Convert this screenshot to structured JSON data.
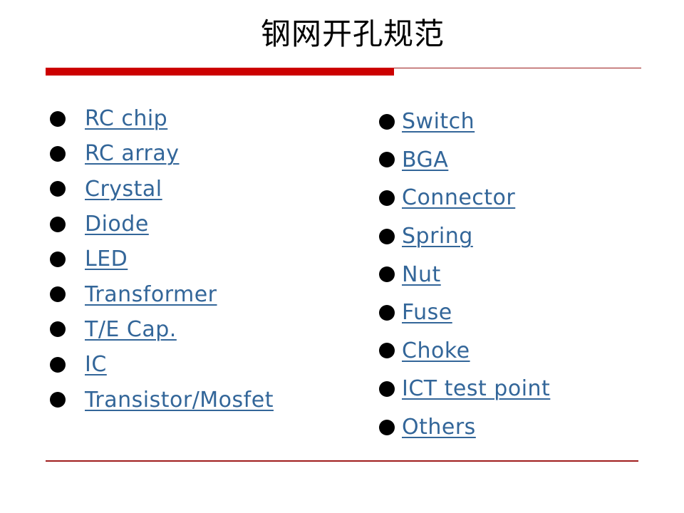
{
  "slide": {
    "title": "钢网开孔规范",
    "colors": {
      "accent_bar": "#cc0000",
      "accent_line": "#9b1b1b",
      "link": "#336699",
      "bullet": "#000000"
    },
    "left_list": {
      "items": [
        {
          "label": "RC chip",
          "icon": "bullet-dot-icon"
        },
        {
          "label": "RC array",
          "icon": "bullet-dot-icon"
        },
        {
          "label": "Crystal",
          "icon": "bullet-dot-icon"
        },
        {
          "label": "Diode",
          "icon": "bullet-dot-icon"
        },
        {
          "label": "LED",
          "icon": "bullet-dot-icon"
        },
        {
          "label": "Transformer",
          "icon": "bullet-dot-icon"
        },
        {
          "label": "T/E Cap.",
          "icon": "bullet-dot-icon"
        },
        {
          "label": "IC",
          "icon": "bullet-dot-icon"
        },
        {
          "label": "Transistor/Mosfet",
          "icon": "bullet-dot-icon"
        }
      ]
    },
    "right_list": {
      "items": [
        {
          "label": "Switch",
          "icon": "bullet-dot-icon"
        },
        {
          "label": "BGA",
          "icon": "bullet-dot-icon"
        },
        {
          "label": "Connector",
          "icon": "bullet-dot-icon"
        },
        {
          "label": "Spring",
          "icon": "bullet-dot-icon"
        },
        {
          "label": "Nut",
          "icon": "bullet-dot-icon"
        },
        {
          "label": "Fuse",
          "icon": "bullet-dot-icon"
        },
        {
          "label": "Choke",
          "icon": "bullet-dot-icon"
        },
        {
          "label": "ICT test point",
          "icon": "bullet-dot-icon"
        },
        {
          "label": "Others",
          "icon": "bullet-dot-icon"
        }
      ]
    }
  }
}
